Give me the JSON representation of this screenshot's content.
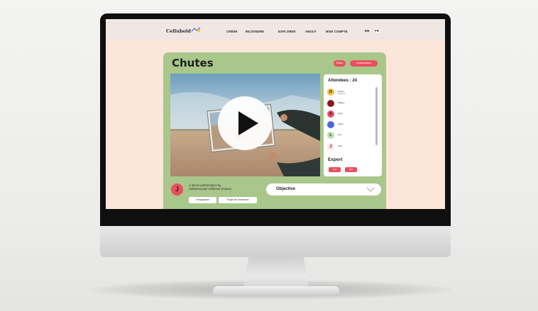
{
  "colors": {
    "accent_red": "#ec4d5f",
    "card_green": "#a9c68b",
    "page_peach": "#fbe6d9",
    "nav_bg": "#f1e7e2"
  },
  "nav": {
    "logo": "Cellubold",
    "links": [
      "CRÉER",
      "REJOINDRE",
      "EXPLORER",
      "ABOUT",
      "MON COMPTE"
    ],
    "languages": [
      "EN",
      "FR"
    ],
    "active_language": "FR"
  },
  "event": {
    "title": "Chutes",
    "actions": [
      "Éditer",
      "Collaborateur"
    ]
  },
  "video": {
    "play_icon": "play-icon"
  },
  "attendees": {
    "title": "Attendees : 24",
    "people": [
      {
        "initial": "D",
        "name": "Daniel",
        "sub": "Organisé",
        "color": "#f3c13a"
      },
      {
        "initial": "",
        "name": "William",
        "sub": "",
        "color": "#8b1a1a"
      },
      {
        "initial": "A",
        "name": "Anna",
        "sub": "",
        "color": "#ec4d5f"
      },
      {
        "initial": "",
        "name": "Adèle",
        "sub": "",
        "color": "#4b66d8"
      },
      {
        "initial": "L",
        "name": "Léo",
        "sub": "",
        "color": "#bfe0b0"
      },
      {
        "initial": "J",
        "name": "Julie",
        "sub": "",
        "color": "#fde3e3"
      }
    ],
    "export_title": "Export",
    "export_buttons": [
      "CSV",
      "PDF"
    ]
  },
  "author": {
    "initial": "J",
    "description_line1": "A dance performance by",
    "description_line2": "Sokelenvouse Cirâncan Chouca"
  },
  "tags": [
    "Géographie",
    "Projet de recherche"
  ],
  "objective": {
    "label": "Objective",
    "chevron_icon": "chevron-down-icon"
  }
}
